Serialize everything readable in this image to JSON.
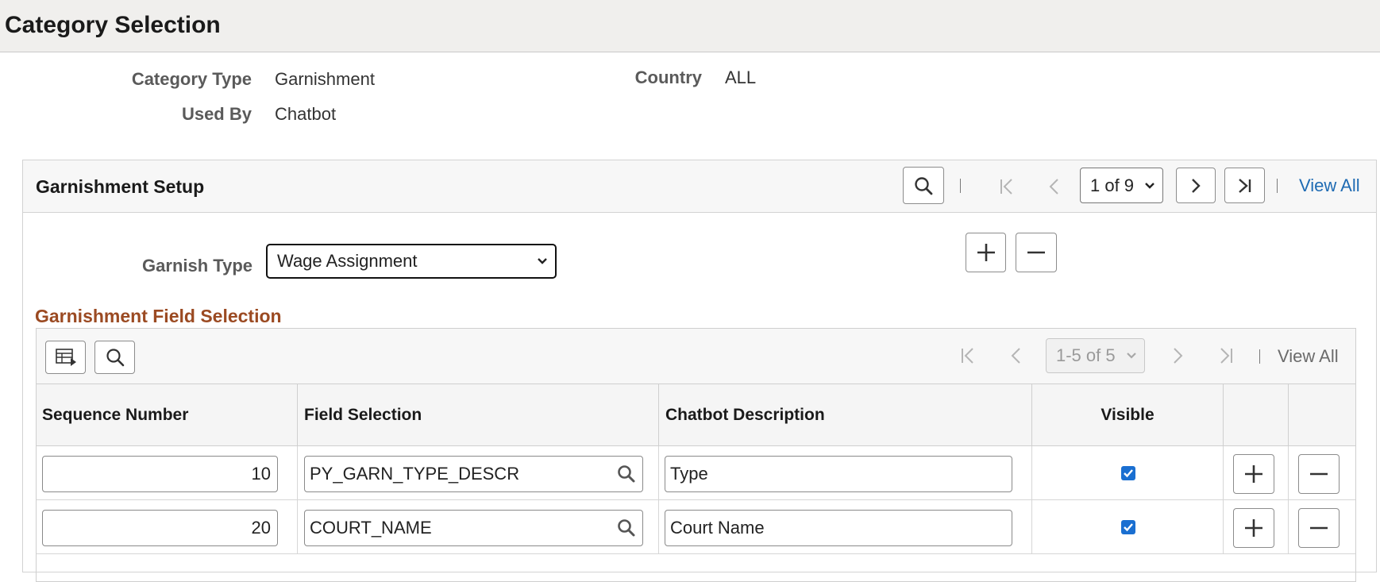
{
  "page": {
    "title": "Category Selection"
  },
  "header_info": {
    "category_type_label": "Category Type",
    "category_type_value": "Garnishment",
    "used_by_label": "Used By",
    "used_by_value": "Chatbot",
    "country_label": "Country",
    "country_value": "ALL"
  },
  "setup": {
    "title": "Garnishment Setup",
    "pagination": {
      "current": "1 of 9",
      "view_all": "View All"
    },
    "garnish_type_label": "Garnish Type",
    "garnish_type_value": "Wage Assignment"
  },
  "field_selection": {
    "title": "Garnishment Field Selection",
    "pagination": {
      "current": "1-5 of 5",
      "view_all": "View All"
    },
    "columns": {
      "sequence": "Sequence Number",
      "field": "Field Selection",
      "description": "Chatbot Description",
      "visible": "Visible"
    },
    "rows": [
      {
        "sequence": "10",
        "field": "PY_GARN_TYPE_DESCR",
        "description": "Type",
        "visible": true
      },
      {
        "sequence": "20",
        "field": "COURT_NAME",
        "description": "Court Name",
        "visible": true
      }
    ]
  },
  "colors": {
    "link": "#1f6bb3",
    "section_title": "#9b4a22",
    "checkbox": "#1a6fd1",
    "header_bg": "#f0efed"
  },
  "icons": [
    "search-icon",
    "first-page-icon",
    "previous-icon",
    "next-icon",
    "last-page-icon",
    "plus-icon",
    "minus-icon",
    "personalize-grid-icon",
    "chevron-down-icon",
    "checkmark-icon"
  ]
}
